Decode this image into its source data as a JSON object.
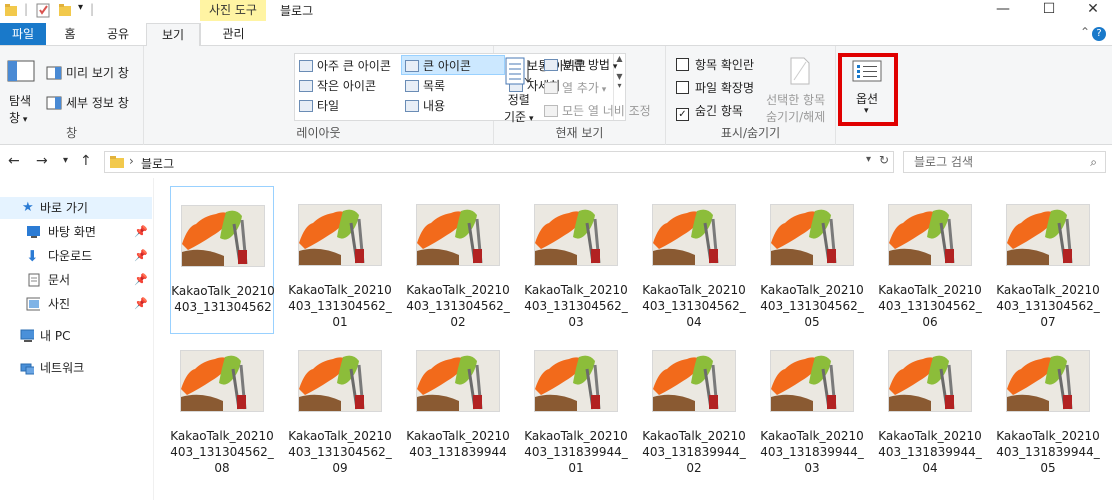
{
  "titlebar": {
    "title": "블로그",
    "context_tab": "사진 도구",
    "min": "—",
    "max": "☐",
    "close": "✕"
  },
  "tabs": [
    "파일",
    "홈",
    "공유",
    "보기",
    "관리"
  ],
  "ribbon": {
    "pane": {
      "navpane": "탐색",
      "navpane2": "창",
      "preview": "미리 보기 창",
      "details": "세부 정보 창",
      "label": "창"
    },
    "layout": {
      "items": [
        "아주 큰 아이콘",
        "큰 아이콘",
        "보통 아이콘",
        "작은 아이콘",
        "목록",
        "자세히",
        "타일",
        "내용"
      ],
      "label": "레이아웃"
    },
    "current_view": {
      "sort1": "정렬",
      "sort2": "기준",
      "group_by": "분류 방법",
      "add_col": "열 추가",
      "fit_cols": "모든 열 너비 조정",
      "label": "현재 보기"
    },
    "show_hide": {
      "item_checkboxes": "항목 확인란",
      "file_ext": "파일 확장명",
      "hidden_items": "숨긴 항목",
      "hide_sel1": "선택한 항목",
      "hide_sel2": "숨기기/해제",
      "label": "표시/숨기기"
    },
    "options": {
      "label": "옵션"
    }
  },
  "address": {
    "path": "블로그",
    "search_placeholder": "블로그 검색"
  },
  "nav": {
    "quick": "바로 가기",
    "desktop": "바탕 화면",
    "downloads": "다운로드",
    "documents": "문서",
    "pictures": "사진",
    "pc": "내 PC",
    "network": "네트워크"
  },
  "files": [
    "KakaoTalk_20210403_131304562",
    "KakaoTalk_20210403_131304562_01",
    "KakaoTalk_20210403_131304562_02",
    "KakaoTalk_20210403_131304562_03",
    "KakaoTalk_20210403_131304562_04",
    "KakaoTalk_20210403_131304562_05",
    "KakaoTalk_20210403_131304562_06",
    "KakaoTalk_20210403_131304562_07",
    "KakaoTalk_20210403_131304562_08",
    "KakaoTalk_20210403_131304562_09",
    "KakaoTalk_20210403_131839944",
    "KakaoTalk_20210403_131839944_01",
    "KakaoTalk_20210403_131839944_02",
    "KakaoTalk_20210403_131839944_03",
    "KakaoTalk_20210403_131839944_04",
    "KakaoTalk_20210403_131839944_05"
  ],
  "colors": {
    "accent": "#1979ca",
    "highlight": "#e00000",
    "selection": "#cce8ff"
  }
}
